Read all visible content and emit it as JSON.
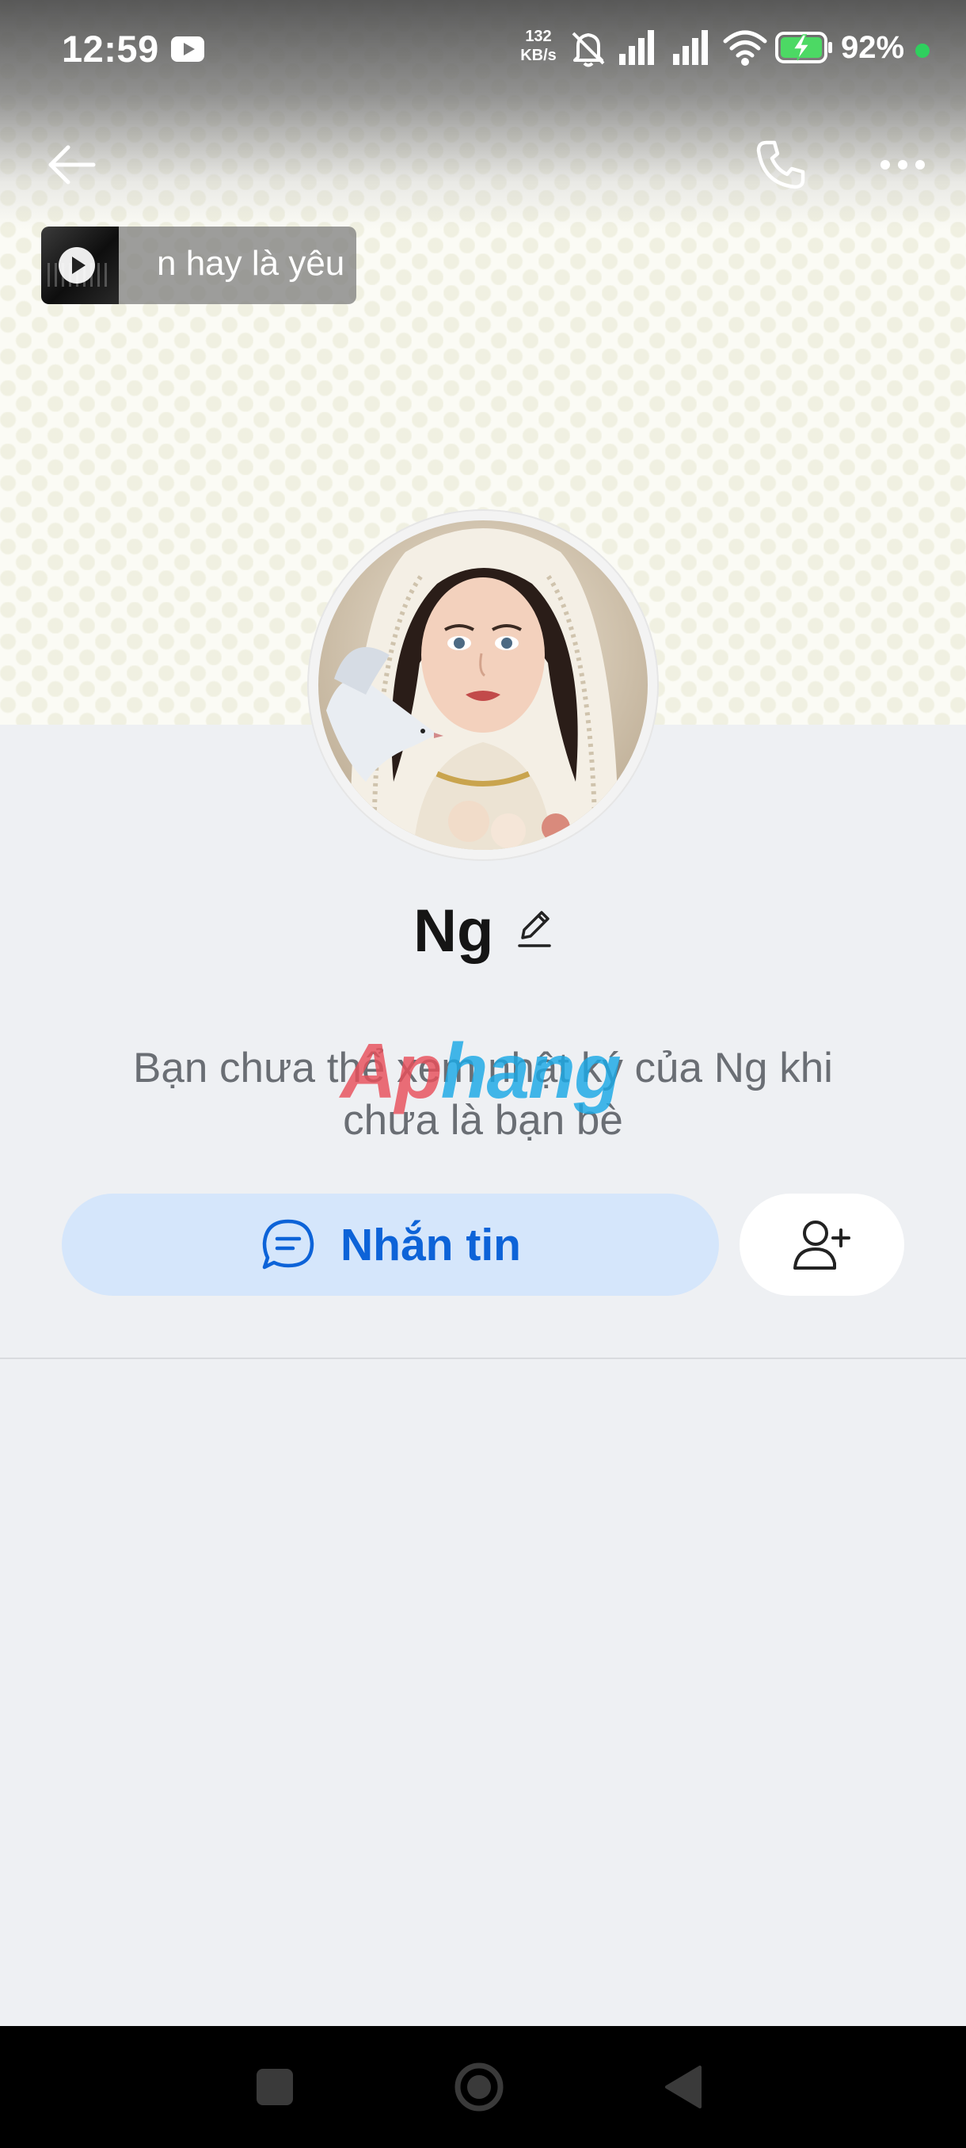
{
  "status_bar": {
    "time": "12:59",
    "net_speed_value": "132",
    "net_speed_unit": "KB/s",
    "battery_percent": "92%",
    "icons": [
      "youtube-icon",
      "bell-off-icon",
      "signal-icon",
      "signal-icon",
      "wifi-icon",
      "battery-charging-icon"
    ]
  },
  "header": {
    "icons": [
      "back-arrow-icon",
      "phone-icon",
      "more-icon"
    ]
  },
  "music": {
    "title": "n hay là yêu",
    "icon": "play-icon"
  },
  "profile": {
    "name": "Ng",
    "edit_icon": "pencil-icon",
    "notice": "Bạn chưa thể xem nhật ký của Ng khi chưa là bạn bè",
    "watermark_a": "Ap",
    "watermark_b": "hang"
  },
  "actions": {
    "message_label": "Nhắn tin",
    "message_icon": "chat-bubble-icon",
    "add_friend_icon": "add-user-icon"
  },
  "nav_bar": {
    "icons": [
      "recents-icon",
      "home-icon",
      "back-icon"
    ]
  },
  "colors": {
    "accent": "#0d63d8",
    "accent_bg": "#d5e6fb",
    "page_bg": "#eef0f3",
    "status_dot": "#2fd05e"
  }
}
